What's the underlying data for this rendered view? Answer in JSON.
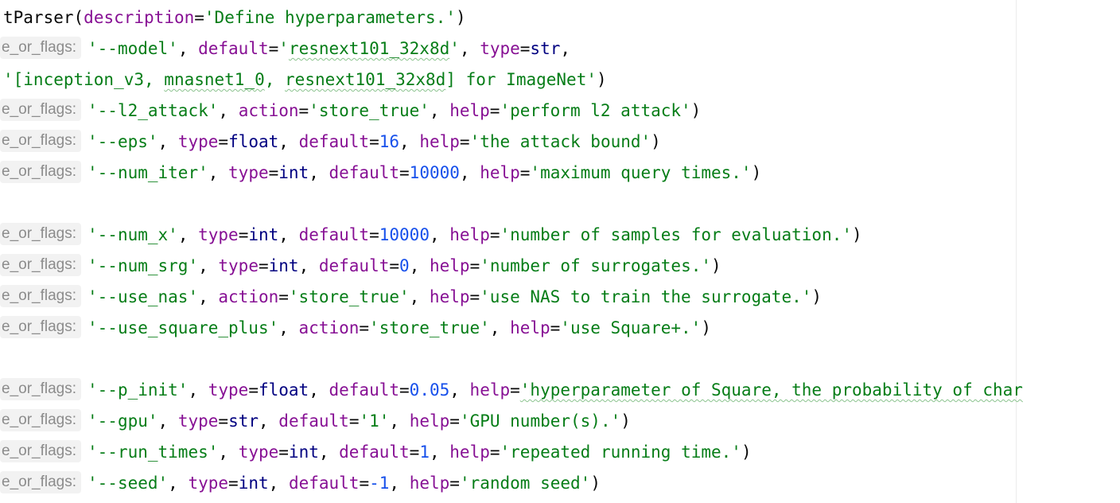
{
  "editor": {
    "hint_label": "e_or_flags:",
    "lines": [
      {
        "hint": false,
        "tokens": [
          {
            "t": "tParser",
            "c": "plain"
          },
          {
            "t": "(",
            "c": "plain"
          },
          {
            "t": "description",
            "c": "kw"
          },
          {
            "t": "=",
            "c": "plain"
          },
          {
            "t": "'Define hyperparameters.'",
            "c": "str"
          },
          {
            "t": ")",
            "c": "plain"
          }
        ]
      },
      {
        "hint": true,
        "tokens": [
          {
            "t": "'--model'",
            "c": "str"
          },
          {
            "t": ", ",
            "c": "plain"
          },
          {
            "t": "default",
            "c": "kw"
          },
          {
            "t": "=",
            "c": "plain"
          },
          {
            "t": "'",
            "c": "str"
          },
          {
            "t": "resnext101_32x8d",
            "c": "str",
            "typo": true
          },
          {
            "t": "'",
            "c": "str"
          },
          {
            "t": ", ",
            "c": "plain"
          },
          {
            "t": "type",
            "c": "kw"
          },
          {
            "t": "=",
            "c": "plain"
          },
          {
            "t": "str",
            "c": "builtin"
          },
          {
            "t": ",",
            "c": "plain"
          }
        ]
      },
      {
        "hint": false,
        "tokens": [
          {
            "t": "'[inception_v3, ",
            "c": "str"
          },
          {
            "t": "mnasnet1_0",
            "c": "str",
            "typo": true
          },
          {
            "t": ", ",
            "c": "str"
          },
          {
            "t": "resnext101_32x8d",
            "c": "str",
            "typo": true
          },
          {
            "t": "] for ImageNet'",
            "c": "str"
          },
          {
            "t": ")",
            "c": "plain"
          }
        ]
      },
      {
        "hint": true,
        "tokens": [
          {
            "t": "'--l2_attack'",
            "c": "str"
          },
          {
            "t": ", ",
            "c": "plain"
          },
          {
            "t": "action",
            "c": "kw"
          },
          {
            "t": "=",
            "c": "plain"
          },
          {
            "t": "'store_true'",
            "c": "str"
          },
          {
            "t": ", ",
            "c": "plain"
          },
          {
            "t": "help",
            "c": "kw"
          },
          {
            "t": "=",
            "c": "plain"
          },
          {
            "t": "'perform l2 attack'",
            "c": "str"
          },
          {
            "t": ")",
            "c": "plain"
          }
        ]
      },
      {
        "hint": true,
        "tokens": [
          {
            "t": "'--eps'",
            "c": "str"
          },
          {
            "t": ", ",
            "c": "plain"
          },
          {
            "t": "type",
            "c": "kw"
          },
          {
            "t": "=",
            "c": "plain"
          },
          {
            "t": "float",
            "c": "builtin"
          },
          {
            "t": ", ",
            "c": "plain"
          },
          {
            "t": "default",
            "c": "kw"
          },
          {
            "t": "=",
            "c": "plain"
          },
          {
            "t": "16",
            "c": "num"
          },
          {
            "t": ", ",
            "c": "plain"
          },
          {
            "t": "help",
            "c": "kw"
          },
          {
            "t": "=",
            "c": "plain"
          },
          {
            "t": "'the attack bound'",
            "c": "str"
          },
          {
            "t": ")",
            "c": "plain"
          }
        ]
      },
      {
        "hint": true,
        "tokens": [
          {
            "t": "'--num_iter'",
            "c": "str"
          },
          {
            "t": ", ",
            "c": "plain"
          },
          {
            "t": "type",
            "c": "kw"
          },
          {
            "t": "=",
            "c": "plain"
          },
          {
            "t": "int",
            "c": "builtin"
          },
          {
            "t": ", ",
            "c": "plain"
          },
          {
            "t": "default",
            "c": "kw"
          },
          {
            "t": "=",
            "c": "plain"
          },
          {
            "t": "10000",
            "c": "num"
          },
          {
            "t": ", ",
            "c": "plain"
          },
          {
            "t": "help",
            "c": "kw"
          },
          {
            "t": "=",
            "c": "plain"
          },
          {
            "t": "'maximum query times.'",
            "c": "str"
          },
          {
            "t": ")",
            "c": "plain"
          }
        ]
      },
      {
        "hint": false,
        "tokens": []
      },
      {
        "hint": true,
        "tokens": [
          {
            "t": "'--num_x'",
            "c": "str"
          },
          {
            "t": ", ",
            "c": "plain"
          },
          {
            "t": "type",
            "c": "kw"
          },
          {
            "t": "=",
            "c": "plain"
          },
          {
            "t": "int",
            "c": "builtin"
          },
          {
            "t": ", ",
            "c": "plain"
          },
          {
            "t": "default",
            "c": "kw"
          },
          {
            "t": "=",
            "c": "plain"
          },
          {
            "t": "10000",
            "c": "num"
          },
          {
            "t": ", ",
            "c": "plain"
          },
          {
            "t": "help",
            "c": "kw"
          },
          {
            "t": "=",
            "c": "plain"
          },
          {
            "t": "'number of samples for evaluation.'",
            "c": "str"
          },
          {
            "t": ")",
            "c": "plain"
          }
        ]
      },
      {
        "hint": true,
        "tokens": [
          {
            "t": "'--num_srg'",
            "c": "str"
          },
          {
            "t": ", ",
            "c": "plain"
          },
          {
            "t": "type",
            "c": "kw"
          },
          {
            "t": "=",
            "c": "plain"
          },
          {
            "t": "int",
            "c": "builtin"
          },
          {
            "t": ", ",
            "c": "plain"
          },
          {
            "t": "default",
            "c": "kw"
          },
          {
            "t": "=",
            "c": "plain"
          },
          {
            "t": "0",
            "c": "num"
          },
          {
            "t": ", ",
            "c": "plain"
          },
          {
            "t": "help",
            "c": "kw"
          },
          {
            "t": "=",
            "c": "plain"
          },
          {
            "t": "'number of surrogates.'",
            "c": "str"
          },
          {
            "t": ")",
            "c": "plain"
          }
        ]
      },
      {
        "hint": true,
        "tokens": [
          {
            "t": "'--use_nas'",
            "c": "str"
          },
          {
            "t": ", ",
            "c": "plain"
          },
          {
            "t": "action",
            "c": "kw"
          },
          {
            "t": "=",
            "c": "plain"
          },
          {
            "t": "'store_true'",
            "c": "str"
          },
          {
            "t": ", ",
            "c": "plain"
          },
          {
            "t": "help",
            "c": "kw"
          },
          {
            "t": "=",
            "c": "plain"
          },
          {
            "t": "'use NAS to train the surrogate.'",
            "c": "str"
          },
          {
            "t": ")",
            "c": "plain"
          }
        ]
      },
      {
        "hint": true,
        "tokens": [
          {
            "t": "'--use_square_plus'",
            "c": "str"
          },
          {
            "t": ", ",
            "c": "plain"
          },
          {
            "t": "action",
            "c": "kw"
          },
          {
            "t": "=",
            "c": "plain"
          },
          {
            "t": "'store_true'",
            "c": "str"
          },
          {
            "t": ", ",
            "c": "plain"
          },
          {
            "t": "help",
            "c": "kw"
          },
          {
            "t": "=",
            "c": "plain"
          },
          {
            "t": "'use Square+.'",
            "c": "str"
          },
          {
            "t": ")",
            "c": "plain"
          }
        ]
      },
      {
        "hint": false,
        "tokens": []
      },
      {
        "hint": true,
        "tokens": [
          {
            "t": "'--p_init'",
            "c": "str"
          },
          {
            "t": ", ",
            "c": "plain"
          },
          {
            "t": "type",
            "c": "kw"
          },
          {
            "t": "=",
            "c": "plain"
          },
          {
            "t": "float",
            "c": "builtin"
          },
          {
            "t": ", ",
            "c": "plain"
          },
          {
            "t": "default",
            "c": "kw"
          },
          {
            "t": "=",
            "c": "plain"
          },
          {
            "t": "0.05",
            "c": "num"
          },
          {
            "t": ", ",
            "c": "plain"
          },
          {
            "t": "help",
            "c": "kw"
          },
          {
            "t": "=",
            "c": "plain"
          },
          {
            "t": "'hyperparameter of Square, the probability of char",
            "c": "str",
            "typo": true
          }
        ]
      },
      {
        "hint": true,
        "tokens": [
          {
            "t": "'--gpu'",
            "c": "str"
          },
          {
            "t": ", ",
            "c": "plain"
          },
          {
            "t": "type",
            "c": "kw"
          },
          {
            "t": "=",
            "c": "plain"
          },
          {
            "t": "str",
            "c": "builtin"
          },
          {
            "t": ", ",
            "c": "plain"
          },
          {
            "t": "default",
            "c": "kw"
          },
          {
            "t": "=",
            "c": "plain"
          },
          {
            "t": "'1'",
            "c": "str"
          },
          {
            "t": ", ",
            "c": "plain"
          },
          {
            "t": "help",
            "c": "kw"
          },
          {
            "t": "=",
            "c": "plain"
          },
          {
            "t": "'GPU number(s).'",
            "c": "str"
          },
          {
            "t": ")",
            "c": "plain"
          }
        ]
      },
      {
        "hint": true,
        "tokens": [
          {
            "t": "'--run_times'",
            "c": "str"
          },
          {
            "t": ", ",
            "c": "plain"
          },
          {
            "t": "type",
            "c": "kw"
          },
          {
            "t": "=",
            "c": "plain"
          },
          {
            "t": "int",
            "c": "builtin"
          },
          {
            "t": ", ",
            "c": "plain"
          },
          {
            "t": "default",
            "c": "kw"
          },
          {
            "t": "=",
            "c": "plain"
          },
          {
            "t": "1",
            "c": "num"
          },
          {
            "t": ", ",
            "c": "plain"
          },
          {
            "t": "help",
            "c": "kw"
          },
          {
            "t": "=",
            "c": "plain"
          },
          {
            "t": "'repeated running time.'",
            "c": "str"
          },
          {
            "t": ")",
            "c": "plain"
          }
        ]
      },
      {
        "hint": true,
        "tokens": [
          {
            "t": "'--seed'",
            "c": "str"
          },
          {
            "t": ", ",
            "c": "plain"
          },
          {
            "t": "type",
            "c": "kw"
          },
          {
            "t": "=",
            "c": "plain"
          },
          {
            "t": "int",
            "c": "builtin"
          },
          {
            "t": ", ",
            "c": "plain"
          },
          {
            "t": "default",
            "c": "kw"
          },
          {
            "t": "=",
            "c": "plain"
          },
          {
            "t": "-1",
            "c": "num"
          },
          {
            "t": ", ",
            "c": "plain"
          },
          {
            "t": "help",
            "c": "kw"
          },
          {
            "t": "=",
            "c": "plain"
          },
          {
            "t": "'random seed'",
            "c": "str"
          },
          {
            "t": ")",
            "c": "plain"
          }
        ]
      }
    ]
  },
  "colors": {
    "string": "#067d17",
    "keyword_argument": "#871094",
    "number": "#1750eb",
    "builtin": "#000080",
    "plain": "#080808",
    "hint_text": "#8c8c8c",
    "hint_background": "#f2f2f2",
    "typo_underline": "#8bc38e"
  }
}
